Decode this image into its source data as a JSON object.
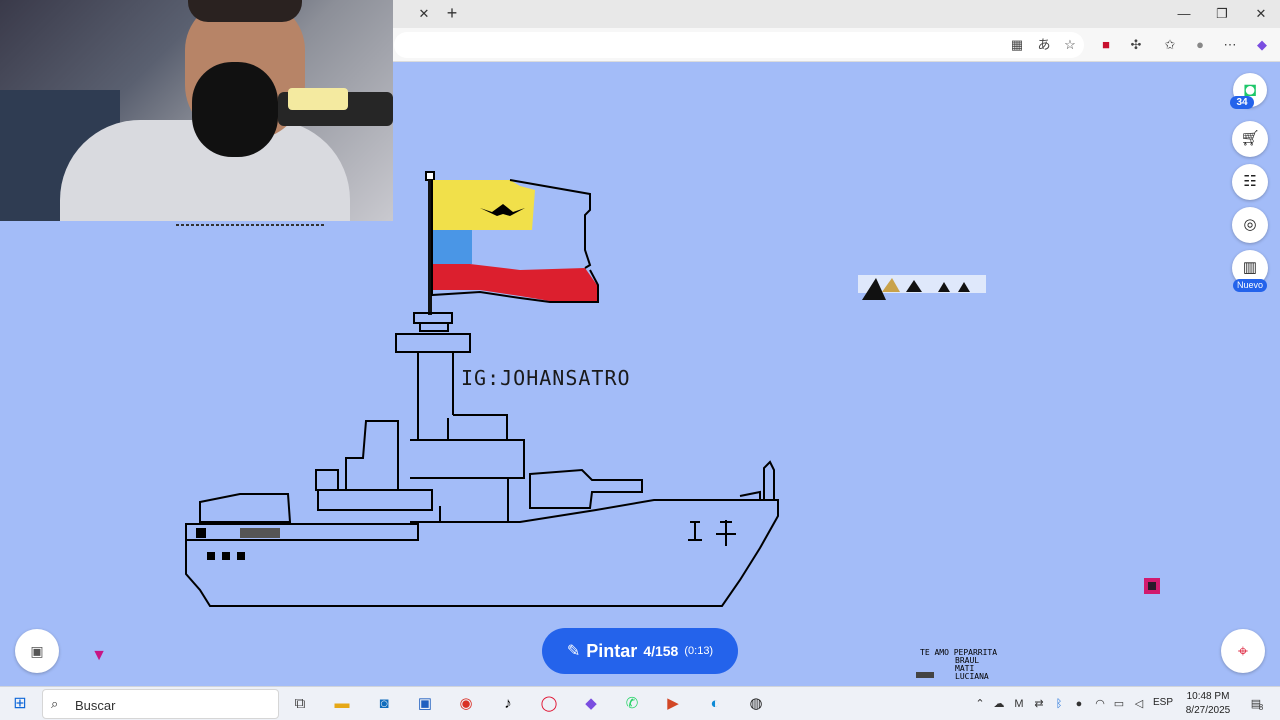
{
  "browser": {
    "tab_close_glyph": "✕",
    "new_tab_glyph": "+",
    "window_controls": [
      "—",
      "❐",
      "✕"
    ],
    "toolbar_icons": [
      "apps-icon",
      "translate-icon",
      "favorite-star-icon",
      "extension-red-icon",
      "extensions-puzzle-icon",
      "favorites-icon",
      "profile-icon",
      "more-icon",
      "copilot-icon"
    ]
  },
  "canvas": {
    "signature_text": "IG:JOHANSATRO",
    "note_lines": [
      "TE AMO PEPARRITA",
      "BRAUL",
      "MATI",
      "LUCIANA"
    ],
    "flag_colors": [
      "#f1e04a",
      "#4a96e6",
      "#dc1f2e"
    ]
  },
  "side_panel": {
    "level_number": "34",
    "nuevo_label": "Nuevo",
    "buttons": [
      "store-icon",
      "community-icon",
      "search-zoom-icon",
      "leaderboard-icon"
    ]
  },
  "paint_button": {
    "label": "Pintar",
    "count": "4/158",
    "timer": "(0:13)"
  },
  "taskbar": {
    "search_label": "Buscar",
    "language": "ESP",
    "time": "10:48 PM",
    "date": "8/27/2025",
    "notification_count": "8"
  }
}
